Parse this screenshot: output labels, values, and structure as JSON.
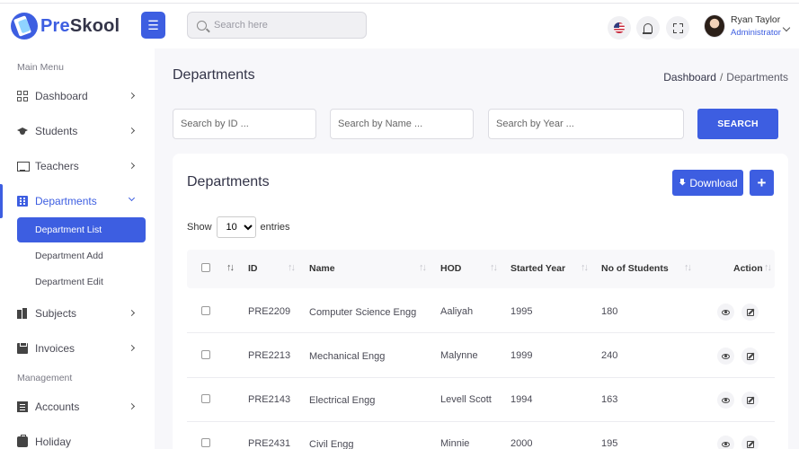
{
  "header": {
    "logo_text_prefix": "Pre",
    "logo_text_suffix": "Skool",
    "search_placeholder": "Search here",
    "user": {
      "name": "Ryan Taylor",
      "role": "Administrator"
    }
  },
  "sidebar": {
    "main_menu_title": "Main Menu",
    "management_title": "Management",
    "items": [
      {
        "label": "Dashboard",
        "icon": "dashboard-icon"
      },
      {
        "label": "Students",
        "icon": "graduation-cap-icon"
      },
      {
        "label": "Teachers",
        "icon": "chalkboard-teacher-icon"
      },
      {
        "label": "Departments",
        "icon": "building-icon"
      },
      {
        "label": "Subjects",
        "icon": "books-icon"
      },
      {
        "label": "Invoices",
        "icon": "clipboard-icon"
      },
      {
        "label": "Accounts",
        "icon": "file-invoice-icon"
      },
      {
        "label": "Holiday",
        "icon": "holiday-icon"
      }
    ],
    "sub_items": [
      {
        "label": "Department List"
      },
      {
        "label": "Department Add"
      },
      {
        "label": "Department Edit"
      }
    ]
  },
  "page": {
    "title": "Departments",
    "breadcrumb": {
      "home": "Dashboard",
      "separator": "/",
      "current": "Departments"
    }
  },
  "filters": {
    "id_placeholder": "Search by ID ...",
    "name_placeholder": "Search by Name ...",
    "year_placeholder": "Search by Year ...",
    "search_label": "SEARCH"
  },
  "card": {
    "title": "Departments",
    "download_label": "Download",
    "add_label": "+",
    "show_label": "Show",
    "entries_value": "10",
    "entries_label": "entries"
  },
  "table": {
    "columns": [
      "ID",
      "Name",
      "HOD",
      "Started Year",
      "No of Students",
      "Action"
    ],
    "rows": [
      {
        "id": "PRE2209",
        "name": "Computer Science Engg",
        "hod": "Aaliyah",
        "year": "1995",
        "students": "180"
      },
      {
        "id": "PRE2213",
        "name": "Mechanical Engg",
        "hod": "Malynne",
        "year": "1999",
        "students": "240"
      },
      {
        "id": "PRE2143",
        "name": "Electrical Engg",
        "hod": "Levell Scott",
        "year": "1994",
        "students": "163"
      },
      {
        "id": "PRE2431",
        "name": "Civil Engg",
        "hod": "Minnie",
        "year": "2000",
        "students": "195"
      }
    ]
  },
  "colors": {
    "accent": "#3d5ee1",
    "background": "#f7f7fa"
  }
}
